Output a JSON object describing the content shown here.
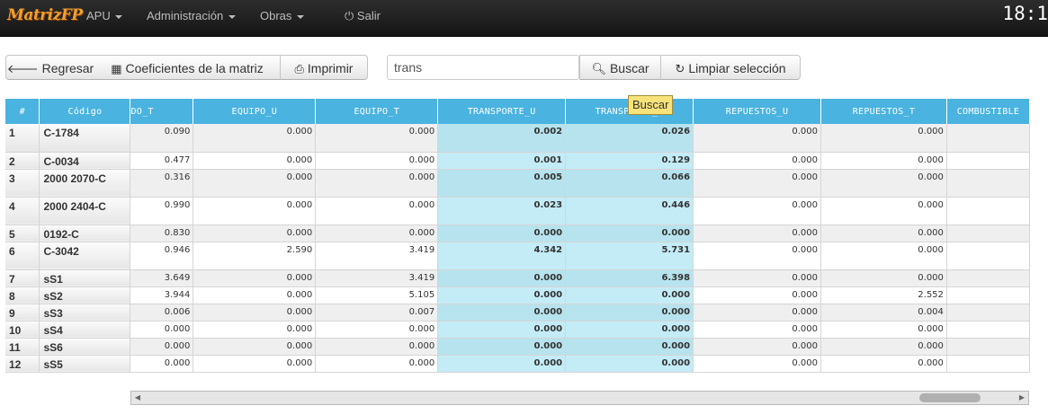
{
  "app": {
    "brand": "MatrizFP",
    "clock": "18:1"
  },
  "nav": {
    "apu": "APU",
    "admin": "Administración",
    "obras": "Obras",
    "salir": "Salir"
  },
  "toolbar": {
    "back_label": "Regresar",
    "coef_label": "Coeficientes de la matriz",
    "print_label": "Imprimir",
    "search_value": "trans",
    "search_btn_label": "Buscar",
    "clear_label": "Limpiar selección",
    "tooltip": "Buscar"
  },
  "table": {
    "idx_header": "#",
    "code_header": "Código",
    "columns": [
      "DO_T",
      "EQUIPO_U",
      "EQUIPO_T",
      "TRANSPORTE_U",
      "TRANSPORTE_T",
      "REPUESTOS_U",
      "REPUESTOS_T",
      "COMBUSTIBLE"
    ],
    "highlight_columns": [
      3,
      4
    ],
    "rows": [
      {
        "idx": "1",
        "code": "C-1784",
        "vals": [
          "0.090",
          "0.000",
          "0.000",
          "0.002",
          "0.026",
          "0.000",
          "0.000",
          ""
        ]
      },
      {
        "idx": "2",
        "code": "C-0034",
        "vals": [
          "0.477",
          "0.000",
          "0.000",
          "0.001",
          "0.129",
          "0.000",
          "0.000",
          ""
        ]
      },
      {
        "idx": "3",
        "code": "2000 2070-C",
        "vals": [
          "0.316",
          "0.000",
          "0.000",
          "0.005",
          "0.066",
          "0.000",
          "0.000",
          ""
        ]
      },
      {
        "idx": "4",
        "code": "2000 2404-C",
        "vals": [
          "0.990",
          "0.000",
          "0.000",
          "0.023",
          "0.446",
          "0.000",
          "0.000",
          ""
        ]
      },
      {
        "idx": "5",
        "code": "0192-C",
        "vals": [
          "0.830",
          "0.000",
          "0.000",
          "0.000",
          "0.000",
          "0.000",
          "0.000",
          ""
        ]
      },
      {
        "idx": "6",
        "code": "C-3042",
        "vals": [
          "0.946",
          "2.590",
          "3.419",
          "4.342",
          "5.731",
          "0.000",
          "0.000",
          ""
        ]
      },
      {
        "idx": "7",
        "code": "sS1",
        "vals": [
          "3.649",
          "0.000",
          "3.419",
          "0.000",
          "6.398",
          "0.000",
          "0.000",
          ""
        ]
      },
      {
        "idx": "8",
        "code": "sS2",
        "vals": [
          "3.944",
          "0.000",
          "5.105",
          "0.000",
          "0.000",
          "0.000",
          "2.552",
          ""
        ]
      },
      {
        "idx": "9",
        "code": "sS3",
        "vals": [
          "0.006",
          "0.000",
          "0.007",
          "0.000",
          "0.000",
          "0.000",
          "0.004",
          ""
        ]
      },
      {
        "idx": "10",
        "code": "sS4",
        "vals": [
          "0.000",
          "0.000",
          "0.000",
          "0.000",
          "0.000",
          "0.000",
          "0.000",
          ""
        ]
      },
      {
        "idx": "11",
        "code": "sS6",
        "vals": [
          "0.000",
          "0.000",
          "0.000",
          "0.000",
          "0.000",
          "0.000",
          "0.000",
          ""
        ]
      },
      {
        "idx": "12",
        "code": "sS5",
        "vals": [
          "0.000",
          "0.000",
          "0.000",
          "0.000",
          "0.000",
          "0.000",
          "0.000",
          ""
        ]
      }
    ]
  },
  "colors": {
    "header_bg": "#4ab3e0",
    "highlight": "#c3ecf7",
    "brand": "#f0a030"
  }
}
